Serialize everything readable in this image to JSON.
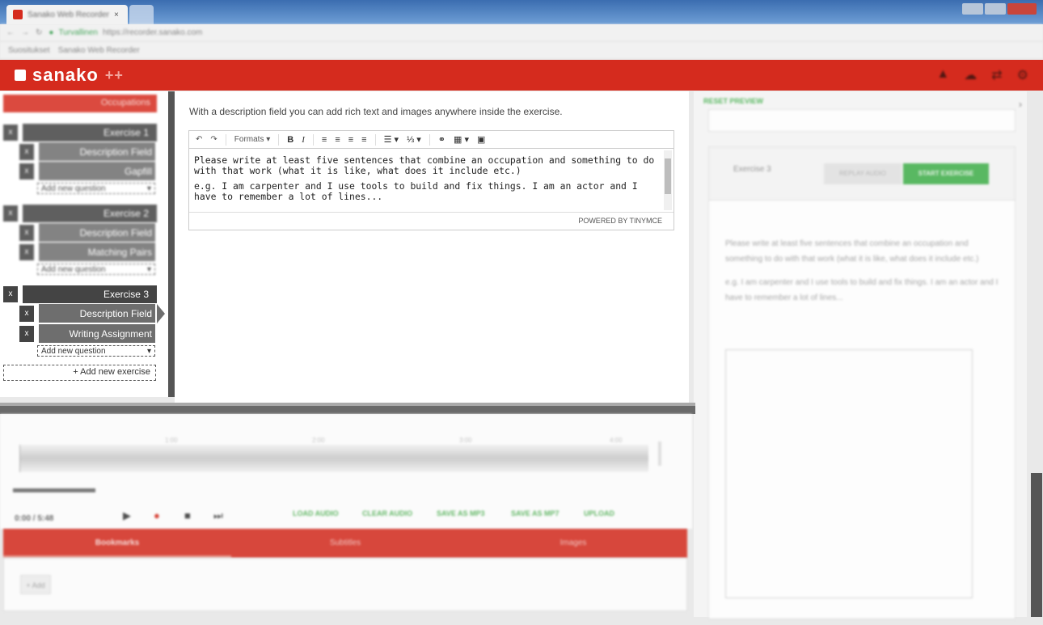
{
  "browser": {
    "tab_title": "Sanako Web Recorder",
    "secure_label": "Turvallinen",
    "url": "https://recorder.sanako.com",
    "bookmarks": [
      "Suositukset",
      "Sanako Web Recorder"
    ]
  },
  "app": {
    "logo": "sanako",
    "accent": "#d52b1e",
    "green": "#3fae49"
  },
  "left": {
    "course": "Occupations",
    "exercises": [
      {
        "x": "x",
        "title": "Exercise 1",
        "questions": [
          "Description Field",
          "Gapfill"
        ],
        "add_q": "Add new question"
      },
      {
        "x": "x",
        "title": "Exercise 2",
        "questions": [
          "Description Field",
          "Matching Pairs"
        ],
        "add_q": "Add new question"
      },
      {
        "x": "x",
        "title": "Exercise 3",
        "questions": [
          "Description Field",
          "Writing Assignment"
        ],
        "add_q": "Add new question"
      }
    ],
    "add_exercise": "+ Add new exercise"
  },
  "editor": {
    "hint": "With a description field you can add rich text and images anywhere inside the exercise.",
    "toolbar": {
      "formats": "Formats",
      "bold": "B",
      "italic": "I"
    },
    "paragraphs": [
      "Please write at least five sentences that combine an occupation and something to do with that work (what it is like, what does it include etc.)",
      "e.g. I am carpenter and I use tools to build and fix things. I am an actor and I have to remember a lot of lines..."
    ],
    "powered_by": "POWERED BY TINYMCE"
  },
  "preview": {
    "reset": "RESET PREVIEW",
    "exercise_title": "Exercise 3",
    "replay": "REPLAY AUDIO",
    "start": "START EXERCISE",
    "paragraphs": [
      "Please write at least five sentences that combine an occupation and something to do with that work (what it is like, what does it include etc.)",
      "e.g. I am carpenter and I use tools to build and fix things. I am an actor and I have to remember a lot of lines..."
    ]
  },
  "audio": {
    "ticks": [
      "1:00",
      "2:00",
      "3:00",
      "4:00"
    ],
    "time": "0:00 / 5:48",
    "links": [
      "LOAD AUDIO",
      "CLEAR AUDIO",
      "SAVE AS MP3",
      "SAVE AS MP7",
      "UPLOAD"
    ]
  },
  "bottom_tabs": [
    "Bookmarks",
    "Subtitles",
    "Images"
  ],
  "bottom": {
    "add": "+ Add"
  }
}
